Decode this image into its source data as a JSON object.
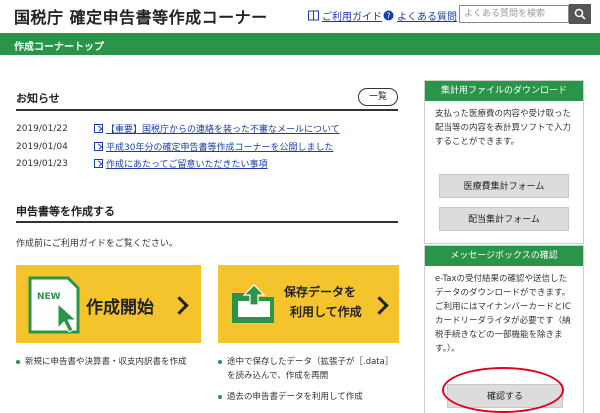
{
  "header": {
    "title": "国税庁 確定申告書等作成コーナー",
    "guide_link": "ご利用ガイド",
    "faq_link": "よくある質問",
    "search_placeholder": "よくある質問を検索"
  },
  "greenbar": {
    "breadcrumb": "作成コーナートップ"
  },
  "news": {
    "title": "お知らせ",
    "list_button": "一覧",
    "items": [
      {
        "date": "2019/01/22",
        "text": "【重要】国税庁からの連絡を装った不審なメールについて"
      },
      {
        "date": "2019/01/04",
        "text": "平成30年分の確定申告書等作成コーナーを公開しました"
      },
      {
        "date": "2019/01/23",
        "text": "作成にあたってご留意いただきたい事項"
      }
    ]
  },
  "create": {
    "title": "申告書等を作成する",
    "intro": "作成前にご利用ガイドをご覧ください。",
    "start_tile": {
      "badge": "NEW",
      "label": "作成開始"
    },
    "resume_tile": {
      "line1": "保存データを",
      "line2": "利用して作成"
    },
    "start_bullets": [
      "新規に申告書や決算書・収支内訳書を作成"
    ],
    "resume_bullets": [
      "途中で保存したデータ（拡張子が［.data］",
      "を読み込んで、作成を再開",
      "過去の申告書データを利用して作成"
    ]
  },
  "download_panel": {
    "title": "集計用ファイルのダウンロード",
    "body_lines": [
      "支払った医療費の内容や受け取った",
      "配当等の内容を表計算ソフトで入力",
      "することができます。"
    ],
    "btn_medical": "医療費集計フォーム",
    "btn_dividend": "配当集計フォーム"
  },
  "message_panel": {
    "title": "メッセージボックスの確認",
    "body_lines": [
      "e-Taxの受付結果の確認や送信した",
      "データのダウンロードができます。",
      "ご利用にはマイナンバーカードとIC",
      "カードリーダライタが必要です（納",
      "税手続きなどの一部機能を除きま",
      "す。）。"
    ],
    "confirm_button": "確認する"
  },
  "colors": {
    "brand_green": "#2a9448",
    "tile_yellow": "#f5c42c",
    "link_blue": "#1a3da8",
    "highlight_red": "#e0001b"
  }
}
